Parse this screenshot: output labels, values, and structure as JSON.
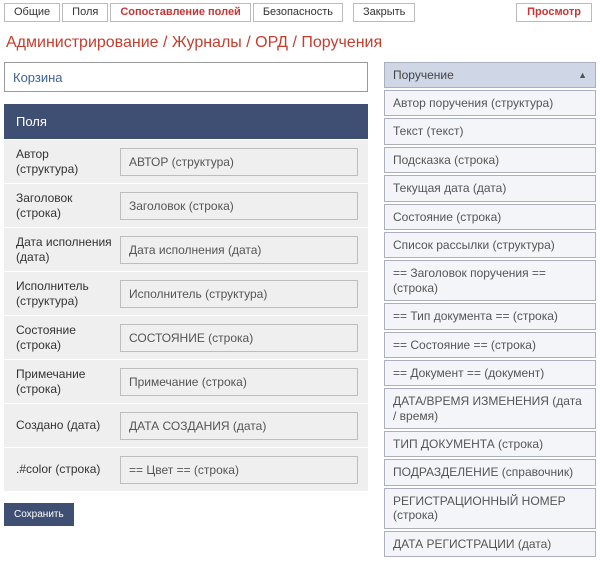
{
  "tabs": [
    {
      "label": "Общие",
      "active": false
    },
    {
      "label": "Поля",
      "active": false
    },
    {
      "label": "Сопоставление полей",
      "active": true
    },
    {
      "label": "Безопасность",
      "active": false
    }
  ],
  "close_label": "Закрыть",
  "preview_label": "Просмотр",
  "breadcrumb": "Администрирование / Журналы / ОРД / Поручения",
  "bucket_value": "Корзина",
  "fields_header": "Поля",
  "save_label": "Сохранить",
  "field_rows": [
    {
      "label": "Автор (структура)",
      "value": "АВТОР (структура)"
    },
    {
      "label": "Заголовок (строка)",
      "value": "Заголовок (строка)"
    },
    {
      "label": "Дата исполнения (дата)",
      "value": "Дата исполнения (дата)"
    },
    {
      "label": "Исполнитель (структура)",
      "value": "Исполнитель (структура)"
    },
    {
      "label": "Состояние (строка)",
      "value": "СОСТОЯНИЕ (строка)"
    },
    {
      "label": "Примечание (строка)",
      "value": "Примечание (строка)"
    },
    {
      "label": "Создано (дата)",
      "value": "ДАТА СОЗДАНИЯ (дата)"
    },
    {
      "label": ".#color (строка)",
      "value": "== Цвет == (строка)"
    }
  ],
  "panel_header": "Поручение",
  "panel_items": [
    "Автор поручения (структура)",
    "Текст (текст)",
    "Подсказка (строка)",
    "Текущая дата (дата)",
    "Состояние (строка)",
    "Список рассылки (структура)",
    "== Заголовок поручения == (строка)",
    "== Тип документа == (строка)",
    "== Состояние == (строка)",
    "== Документ == (документ)",
    "ДАТА/ВРЕМЯ ИЗМЕНЕНИЯ (дата / время)",
    "ТИП ДОКУМЕНТА (строка)",
    "ПОДРАЗДЕЛЕНИЕ (справочник)",
    "РЕГИСТРАЦИОННЫЙ НОМЕР (строка)",
    "ДАТА РЕГИСТРАЦИИ (дата)"
  ]
}
